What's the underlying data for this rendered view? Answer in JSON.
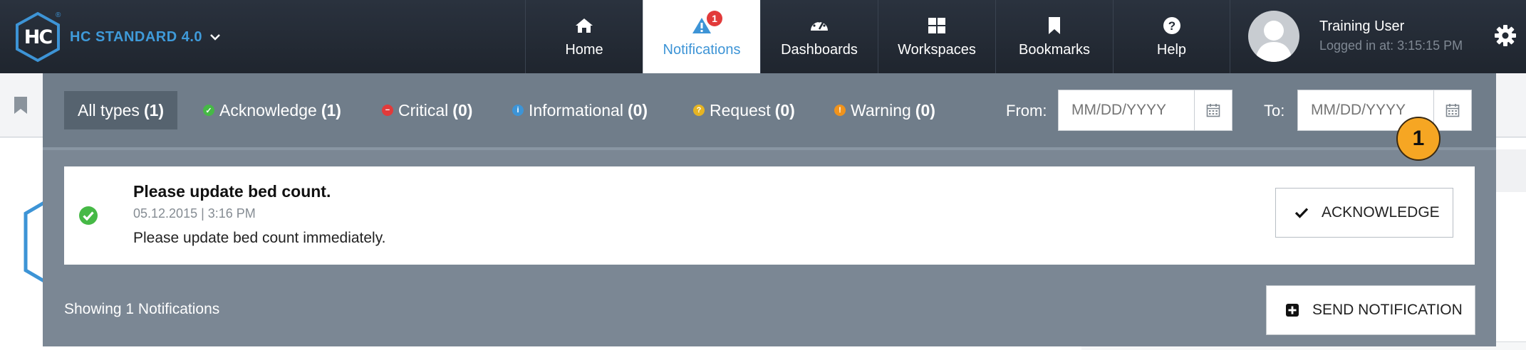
{
  "brand": {
    "logo_text": "HC",
    "title": "HC STANDARD 4.0"
  },
  "nav": {
    "tabs": [
      {
        "label": "Home",
        "icon": "home-icon"
      },
      {
        "label": "Notifications",
        "icon": "alert-icon",
        "badge": "1"
      },
      {
        "label": "Dashboards",
        "icon": "dashboard-icon"
      },
      {
        "label": "Workspaces",
        "icon": "grid-icon"
      },
      {
        "label": "Bookmarks",
        "icon": "bookmark-icon"
      },
      {
        "label": "Help",
        "icon": "help-icon"
      }
    ],
    "active_tab": "Notifications"
  },
  "user": {
    "name": "Training User",
    "login": "Logged in at: 3:15:15 PM"
  },
  "filters": [
    {
      "label": "All types",
      "count": "(1)",
      "color": "",
      "active": true
    },
    {
      "label": "Acknowledge",
      "count": "(1)",
      "color": "#46b946"
    },
    {
      "label": "Critical",
      "count": "(0)",
      "color": "#e23a3a"
    },
    {
      "label": "Informational",
      "count": "(0)",
      "color": "#3d94d6"
    },
    {
      "label": "Request",
      "count": "(0)",
      "color": "#e6b422"
    },
    {
      "label": "Warning",
      "count": "(0)",
      "color": "#f0931c"
    }
  ],
  "date_range": {
    "from_label": "From:",
    "from_placeholder": "MM/DD/YYYY",
    "to_label": "To:",
    "to_placeholder": "MM/DD/YYYY"
  },
  "notification": {
    "title": "Please update bed count.",
    "date": "05.12.2015 | 3:16 PM",
    "body": "Please update bed count immediately.",
    "action_label": "ACKNOWLEDGE"
  },
  "step_marker": "1",
  "footer": {
    "showing": "Showing 1 Notifications",
    "send_label": "SEND NOTIFICATION"
  },
  "colors": {
    "accent": "#3d94d6",
    "topbar": "#222a34",
    "panel": "#7b8794",
    "success": "#46b946",
    "marker": "#f6a623"
  }
}
